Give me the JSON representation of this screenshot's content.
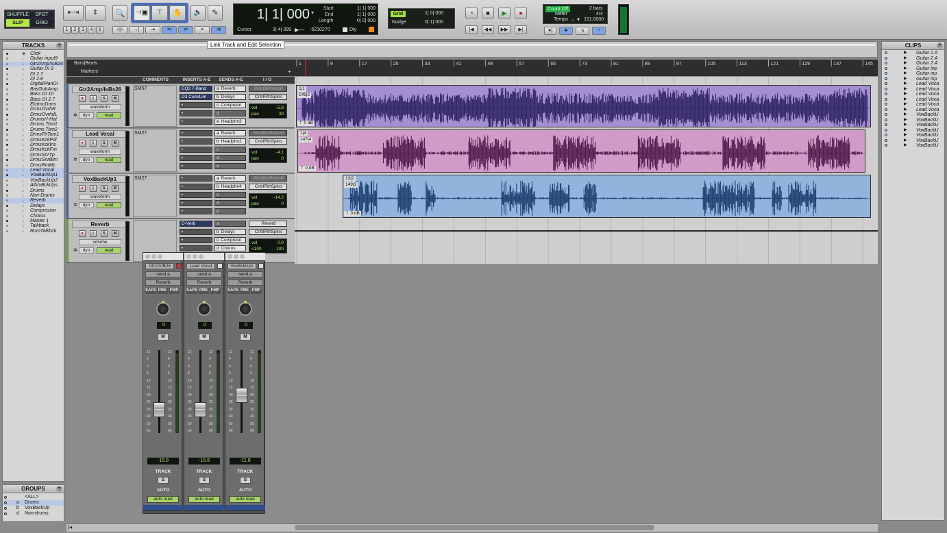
{
  "toolbar": {
    "modes": [
      "SHUFFLE",
      "SPOT",
      "SLIP",
      "GRID"
    ],
    "zoom_presets": [
      "1",
      "2",
      "3",
      "4",
      "5"
    ],
    "tooltip": "Link Track and Edit Selection"
  },
  "counter": {
    "main": "1| 1| 000",
    "start_label": "Start",
    "start_value": "1| 1| 000",
    "end_label": "End",
    "end_value": "1| 1| 000",
    "length_label": "Length",
    "length_value": "0| 0| 000",
    "cursor_label": "Cursor",
    "cursor_value": "3| 4| 399",
    "cursor_sample": "-5210270",
    "dly_label": "Dly"
  },
  "grid_nudge": {
    "grid_label": "Grid",
    "grid_value": "1| 0| 000",
    "nudge_label": "Nudge",
    "nudge_value": "0| 1| 000"
  },
  "transport_info": {
    "countoff": "Count Off",
    "bars": "2 bars",
    "meter_label": "Meter",
    "meter_value": "4/4",
    "tempo_label": "Tempo",
    "tempo_value": "151.0000"
  },
  "tracks_panel": {
    "title": "TRACKS",
    "items": [
      "Click",
      "Guitar input9",
      "Gtr2Amp/IsB26",
      "Guitar DI 9",
      "DI 2.7",
      "DI 2.8",
      "DigitalPianDI",
      "BasGutrAmp",
      "Bass DI 10",
      "Bass DI 2.7",
      "ElctrncDrms",
      "DrmsOvrhR",
      "DrmsOvrhdL",
      "DrumsH-Hat",
      "Drums Tom1",
      "Drums Tom2",
      "DrmsFlrTom1",
      "DrmsKckPdl",
      "DrmsKckIns",
      "DrmsKckFrn",
      "DrmsSnrTp",
      "DrmsSnrBtm",
      "DrmsRmMc",
      "Lead Vocal",
      "VoxBackUp1",
      "VoxBackUp2",
      "AllVxBckUps",
      "Drums",
      "Non-Drums",
      "Reverb",
      "Delays",
      "Compresion",
      "Chorus",
      "Master 1",
      "Talkback",
      "RomTalkbck"
    ],
    "selected": [
      2,
      23,
      24,
      29
    ]
  },
  "groups_panel": {
    "title": "GROUPS",
    "items": [
      {
        "id": "",
        "name": "<ALL>"
      },
      {
        "id": "a",
        "name": "Drums"
      },
      {
        "id": "b",
        "name": "VoxBackUp"
      },
      {
        "id": "d",
        "name": "Non-drums"
      }
    ]
  },
  "clips_panel": {
    "title": "CLIPS",
    "items": [
      "Guitar 2 A",
      "Guitar 2 A",
      "Guitar 2 A",
      "Guitar Inp",
      "Guitar inp",
      "Guitar inp",
      "Lead Voca",
      "Lead Voca",
      "Lead Voca",
      "Lead Voca",
      "Lead Voca",
      "Lead Voca",
      "VoxBackU",
      "VoxBackU",
      "VoxBackU",
      "VoxBackU",
      "VoxBackU",
      "VoxBackU",
      "VoxBackU"
    ]
  },
  "rulers": {
    "bars_label": "Bars|Beats",
    "markers_label": "Markers",
    "ticks": [
      "1",
      "9",
      "17",
      "25",
      "33",
      "41",
      "49",
      "57",
      "65",
      "73",
      "81",
      "89",
      "97",
      "105",
      "113",
      "121",
      "129",
      "137",
      "145"
    ]
  },
  "edit_columns": [
    "COMMENTS",
    "INSERTS A-E",
    "SENDS A-E",
    "I / O"
  ],
  "tracks": [
    {
      "name": "Gtr2Amp/IsBx26",
      "view": "waveform",
      "dyn": "dyn",
      "auto": "read",
      "comment": "SM57",
      "inserts": [
        "EQ3 7-Band",
        "D3 Com/Lim"
      ],
      "sends": [
        "Reverb",
        "Delays",
        "Compresn",
        "",
        "Headphn3"
      ],
      "io_in": "8GtrDIPhntmP",
      "io_out": "CntrlRthSpkrs",
      "vol": "-5.9",
      "pan": "39",
      "clip_top": "1|1",
      "clip_bot": "149|2",
      "clip_gain": "0 dB"
    },
    {
      "name": "Lead Vocal",
      "view": "waveform",
      "dyn": "dyn",
      "auto": "read",
      "comment": "SM27",
      "inserts": [],
      "sends": [
        "Reverb",
        "Headphn2"
      ],
      "io_in": "8VclMcPhntmP",
      "io_out": "CntrlRthSpkrs",
      "vol": "-4.1",
      "pan": "0",
      "clip_top": "1|4",
      "clip_bot": "147|4",
      "clip_gain": "0 dB"
    },
    {
      "name": "VoxBackUp1",
      "view": "waveform",
      "dyn": "dyn",
      "auto": "read",
      "comment": "SM27",
      "inserts": [],
      "sends": [
        "Reverb",
        "Headphn4"
      ],
      "io_in": "8VclMcPhntmP",
      "io_out": "CntrlRthSpkrs",
      "vol": "-14.2",
      "pan": "0",
      "clip_top": "13|2",
      "clip_bot": "149|1",
      "clip_gain": "0 dB"
    },
    {
      "name": "Reverb",
      "view": "volume",
      "dyn": "dyn",
      "auto": "read",
      "comment": "",
      "inserts": [
        "D-Verb"
      ],
      "sends": [
        "",
        "Delays",
        "Compresn",
        "Chorus"
      ],
      "io_in": "Reverb",
      "io_out": "CntrlRthSpkrs",
      "vol": "0.0",
      "pan": "100",
      "pan_left": "<100"
    }
  ],
  "mixer_strips": [
    {
      "name": "Gtr2A/IB26",
      "send": "send a",
      "send_dest": "Reverb",
      "pan": "0",
      "fader": "-15.8",
      "fader_level": 0.34,
      "mute": "M",
      "solo": "S",
      "track": "TRACK",
      "auto_label": "AUTO",
      "auto_mode": "auto read"
    },
    {
      "name": "Lead Vocal",
      "send": "send a",
      "send_dest": "Reverb",
      "pan": "0",
      "fader": "-15.8",
      "fader_level": 0.34,
      "mute": "M",
      "solo": "S",
      "track": "TRACK",
      "auto_label": "AUTO",
      "auto_mode": "auto read"
    },
    {
      "name": "VoxBckUp1",
      "send": "send a",
      "send_dest": "Reverb",
      "pan": "0",
      "fader": "-11.8",
      "fader_level": 0.52,
      "mute": "M",
      "solo": "S",
      "track": "TRACK",
      "auto_label": "AUTO",
      "auto_mode": "auto read"
    }
  ],
  "strip_buttons": [
    "SAFE",
    "PRE",
    "FMP"
  ],
  "fader_scale": [
    "12",
    "6",
    "0",
    "5",
    "10",
    "15",
    "20",
    "25",
    "30",
    "40",
    "50",
    "60"
  ],
  "colors": {
    "clip1": "#a58fd3",
    "clip2": "#cf9cc8",
    "clip3": "#93b3dc",
    "wave1": "#2a1f5e",
    "wave2": "#4b1545",
    "wave3": "#173a6a"
  }
}
